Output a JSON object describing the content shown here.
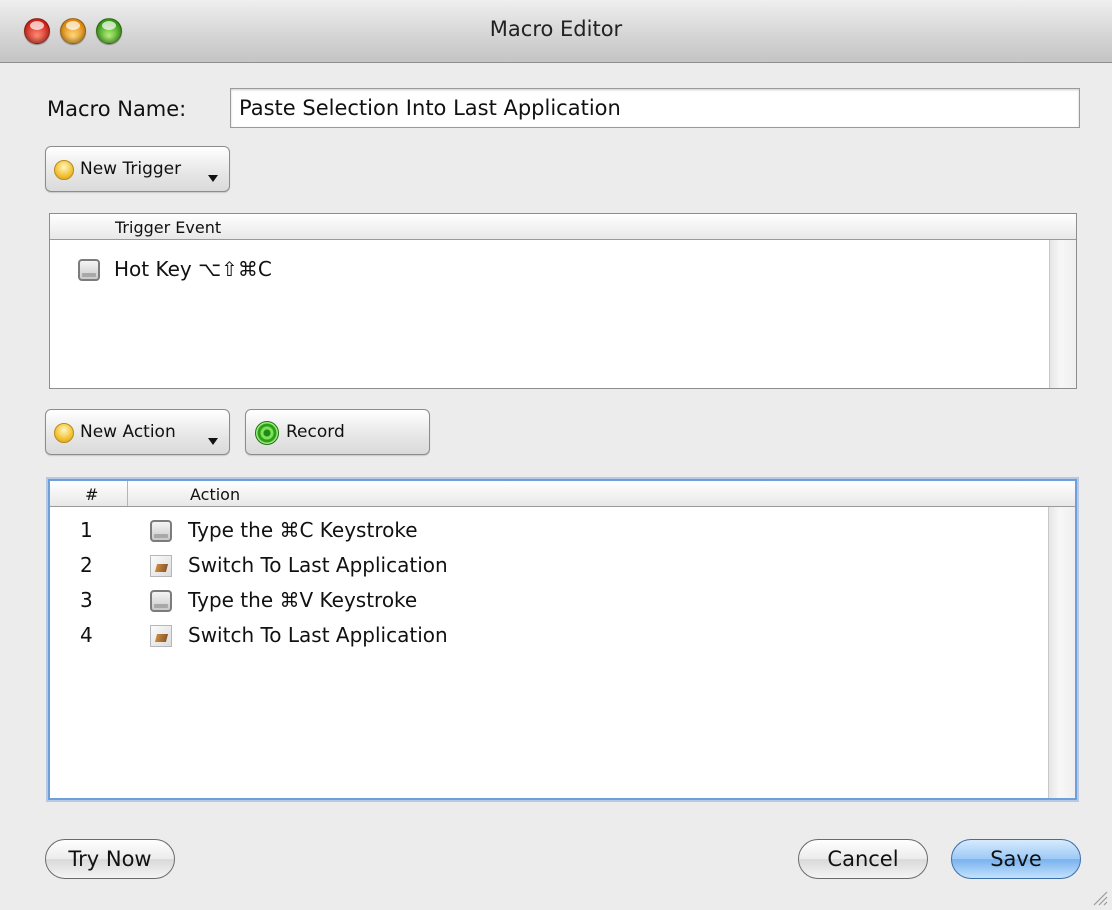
{
  "window": {
    "title": "Macro Editor"
  },
  "macro_name": {
    "label": "Macro Name:",
    "value": "Paste Selection Into Last Application"
  },
  "trigger_section": {
    "new_trigger_label": "New Trigger",
    "column_header": "Trigger Event",
    "rows": [
      {
        "icon": "keyboard-key-icon",
        "text": "Hot Key ⌥⇧⌘C"
      }
    ]
  },
  "action_section": {
    "new_action_label": "New Action",
    "record_label": "Record",
    "columns": [
      "#",
      "Action"
    ],
    "rows": [
      {
        "num": "1",
        "icon": "keyboard-key-icon",
        "text": "Type the ⌘C Keystroke"
      },
      {
        "num": "2",
        "icon": "application-icon",
        "text": "Switch To Last Application"
      },
      {
        "num": "3",
        "icon": "keyboard-key-icon",
        "text": "Type the ⌘V Keystroke"
      },
      {
        "num": "4",
        "icon": "application-icon",
        "text": "Switch To Last Application"
      }
    ]
  },
  "footer": {
    "try_now": "Try Now",
    "cancel": "Cancel",
    "save": "Save"
  },
  "colors": {
    "default_button": "#8fc1f3",
    "focus_ring": "#6f9fd8",
    "record": "#2c9e1a"
  }
}
